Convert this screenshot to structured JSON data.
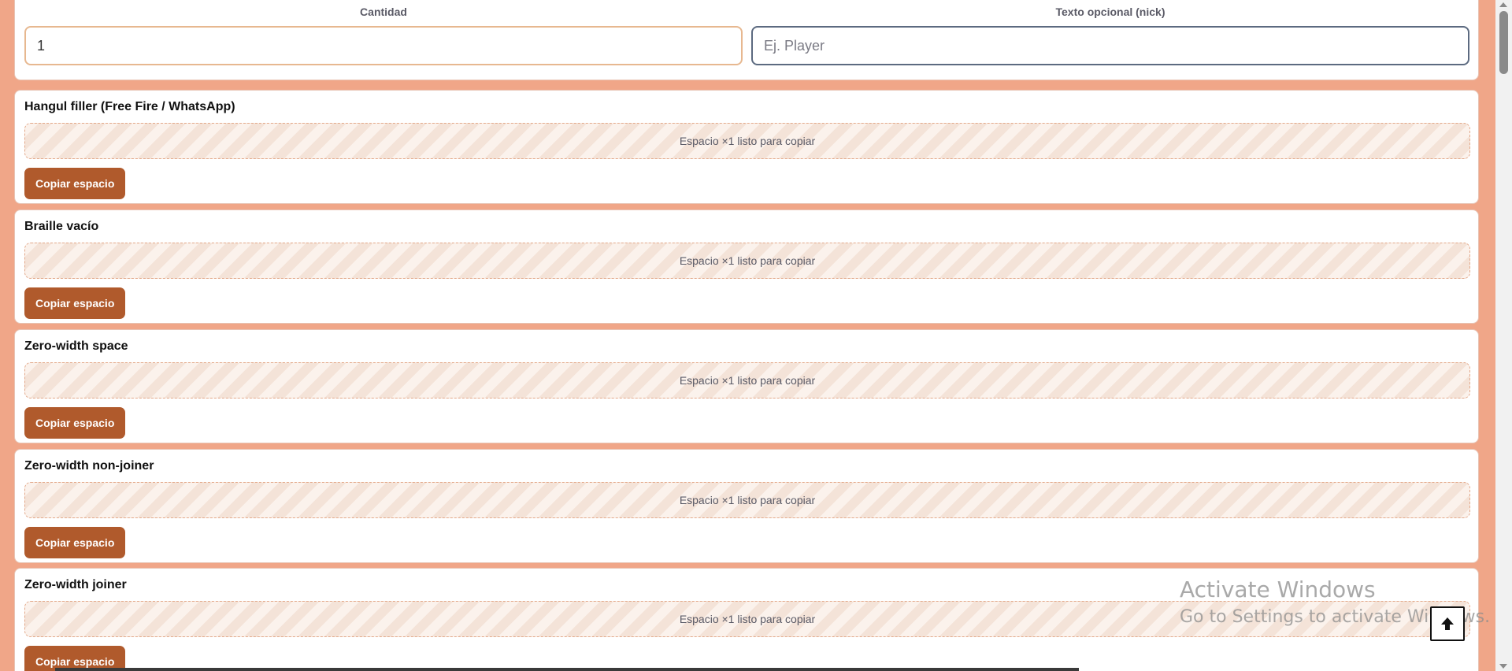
{
  "form": {
    "quantity_label": "Cantidad",
    "quantity_value": "1",
    "nick_label": "Texto opcional (nick)",
    "nick_placeholder": "Ej. Player"
  },
  "options": [
    {
      "title": "Hangul filler (Free Fire / WhatsApp)",
      "preview": "Espacio ×1 listo para copiar",
      "button": "Copiar espacio"
    },
    {
      "title": "Braille vacío",
      "preview": "Espacio ×1 listo para copiar",
      "button": "Copiar espacio"
    },
    {
      "title": "Zero-width space",
      "preview": "Espacio ×1 listo para copiar",
      "button": "Copiar espacio"
    },
    {
      "title": "Zero-width non-joiner",
      "preview": "Espacio ×1 listo para copiar",
      "button": "Copiar espacio"
    },
    {
      "title": "Zero-width joiner",
      "preview": "Espacio ×1 listo para copiar",
      "button": "Copiar espacio"
    }
  ],
  "watermark": {
    "line1": "Activate Windows",
    "line2": "Go to Settings to activate Windows."
  },
  "icons": {
    "back_to_top": "arrow-up-icon"
  },
  "colors": {
    "page_bg": "#f0a688",
    "button_bg": "#b05a2c",
    "input_focus_border": "#e7b890"
  }
}
